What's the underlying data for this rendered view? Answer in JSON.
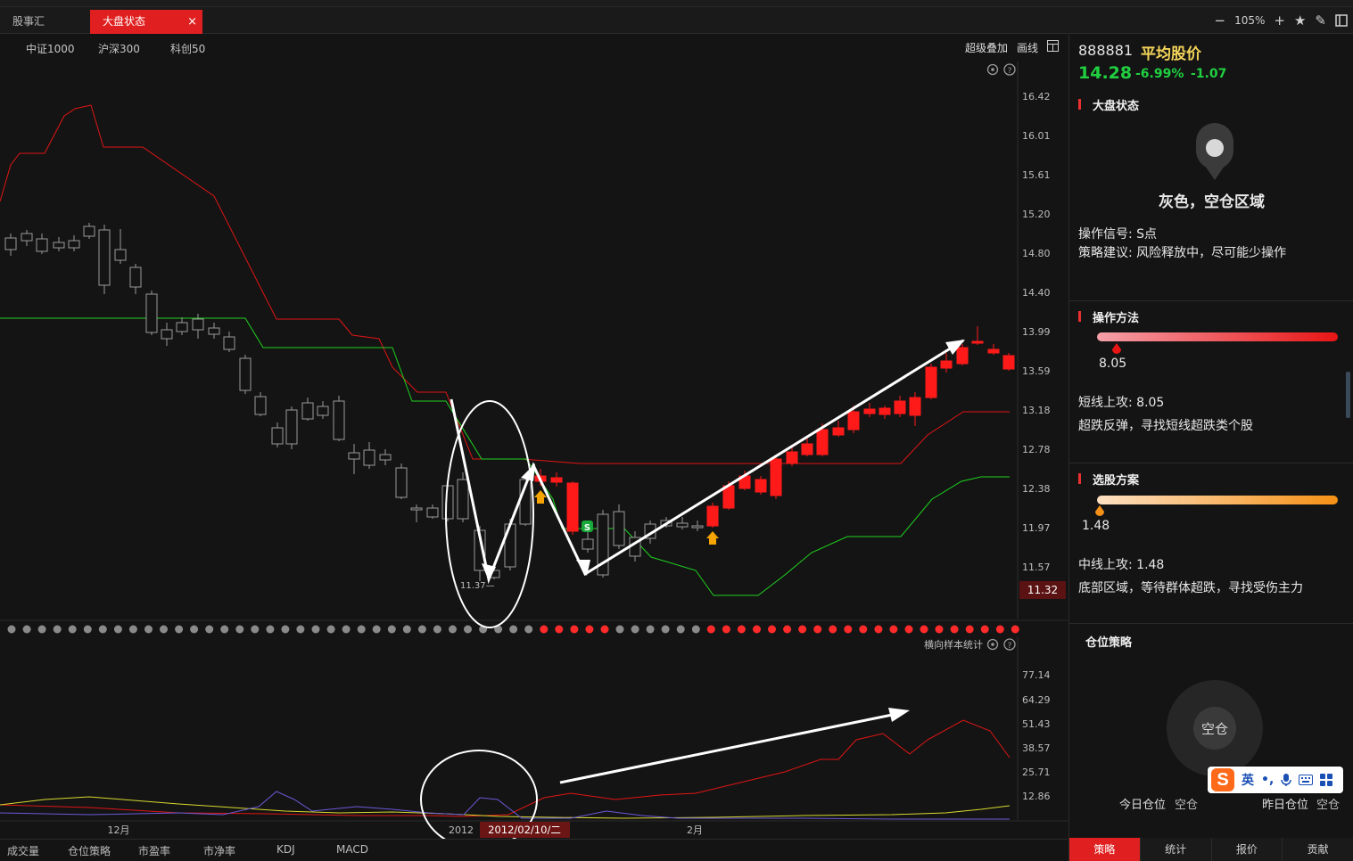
{
  "tabs": [
    {
      "label": "股事汇"
    },
    {
      "label": "大盘状态",
      "close": "×"
    }
  ],
  "zoom": {
    "value": "105%",
    "minus": "−",
    "plus": "+",
    "star": "★",
    "pen": "✎"
  },
  "subbar": {
    "indices": [
      "中证1000",
      "沪深300",
      "科创50"
    ],
    "tools": [
      "超级叠加",
      "画线"
    ]
  },
  "chart": {
    "price_ticks": [
      "16.42",
      "16.01",
      "15.61",
      "15.20",
      "14.80",
      "14.40",
      "13.99",
      "13.59",
      "13.18",
      "12.78",
      "12.38",
      "11.97",
      "11.57"
    ],
    "current_price": "11.32",
    "low_label": "11.37",
    "signals": {
      "s": "S"
    },
    "lower_title": "横向样本统计",
    "lower_ticks": [
      "77.14",
      "64.29",
      "51.43",
      "38.57",
      "25.71",
      "12.86"
    ],
    "date_labels": [
      "12月",
      "2012",
      "2月"
    ],
    "cursor_date": "2012/02/10/二"
  },
  "chart_data": {
    "type": "line",
    "title": "",
    "y_ticks": [
      16.42,
      16.01,
      15.61,
      15.2,
      14.8,
      14.4,
      13.99,
      13.59,
      13.18,
      12.78,
      12.38,
      11.97,
      11.57
    ],
    "current_value": 11.32,
    "annotated_low": 11.37,
    "lower_y_ticks": [
      77.14,
      64.29,
      51.43,
      38.57,
      25.71,
      12.86
    ],
    "x_labels": [
      "12月",
      "2012",
      "2月"
    ],
    "colors": {
      "up": "#ff1a1a",
      "down_grey": "#9a9a9a",
      "down_green": "#19c23a",
      "resist": "#e01515",
      "support": "#1fd21f"
    }
  },
  "bottomtabs": [
    "成交量",
    "仓位策略",
    "市盈率",
    "市净率",
    "KDJ",
    "MACD"
  ],
  "panel": {
    "code": "888881",
    "name": "平均股价",
    "price": "14.28",
    "pct": "-6.99%",
    "chg": "-1.07",
    "state_section": "大盘状态",
    "state_text": "灰色，空仓区域",
    "signal_label": "操作信号: S点",
    "advice_label": "策略建议: 风险释放中，尽可能少操作",
    "method_section": "操作方法",
    "method_value": "8.05",
    "method_line1": "短线上攻: 8.05",
    "method_line2": "超跌反弹，寻找短线超跌类个股",
    "select_section": "选股方案",
    "select_value": "1.48",
    "select_line1": "中线上攻: 1.48",
    "select_line2": "底部区域，等待群体超跌，寻找受伤主力",
    "position_section": "仓位策略",
    "position_text": "空仓",
    "today_label": "今日仓位",
    "today_value": "空仓",
    "yesterday_label": "昨日仓位",
    "yesterday_value": "空仓",
    "tabs": [
      "策略",
      "统计",
      "报价",
      "贡献"
    ]
  },
  "ime": {
    "logo": "S",
    "mode": "英",
    "punct": "•,"
  },
  "colors": {
    "accent": "#e02020",
    "green": "#20d040",
    "gold": "#f3d45a"
  }
}
